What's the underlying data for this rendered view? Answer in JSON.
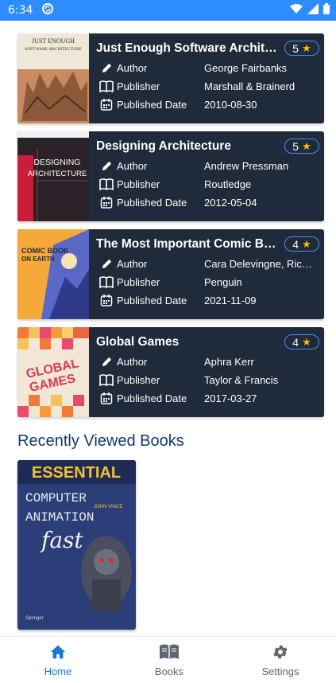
{
  "status_bar": {
    "time": "6:34"
  },
  "books": [
    {
      "title": "Just Enough Software Architecture: A Risk-Driven Approach",
      "rating": "5",
      "author_label": "Author",
      "author": "George Fairbanks",
      "publisher_label": "Publisher",
      "publisher": "Marshall & Brainerd",
      "date_label": "Published Date",
      "date": "2010-08-30",
      "cover": {
        "line1": "JUST ENOUGH",
        "line2": "SOFTWARE ARCHITECTURE"
      }
    },
    {
      "title": "Designing Architecture",
      "rating": "5",
      "author_label": "Author",
      "author": "Andrew Pressman",
      "publisher_label": "Publisher",
      "publisher": "Routledge",
      "date_label": "Published Date",
      "date": "2012-05-04",
      "cover": {
        "line1": "DESIGNING",
        "line2": "ARCHITECTURE"
      }
    },
    {
      "title": "The Most Important Comic Book on Earth",
      "rating": "4",
      "author_label": "Author",
      "author": "Cara Delevingne, Ricky Gervais",
      "publisher_label": "Publisher",
      "publisher": "Penguin",
      "date_label": "Published Date",
      "date": "2021-11-09",
      "cover": {
        "line1": "COMIC BOOK",
        "line2": "ON EARTH"
      }
    },
    {
      "title": "Global Games",
      "rating": "4",
      "author_label": "Author",
      "author": "Aphra Kerr",
      "publisher_label": "Publisher",
      "publisher": "Taylor & Francis",
      "date_label": "Published Date",
      "date": "2017-03-27",
      "cover": {
        "line1": "GLOBAL",
        "line2": "GAMES"
      }
    }
  ],
  "recent": {
    "title": "Recently Viewed Books",
    "cover": {
      "line1": "ESSENTIAL",
      "line2": "COMPUTER",
      "line3": "ANIMATION",
      "line4": "fast",
      "author": "JOHN VINCE"
    }
  },
  "nav": {
    "home": "Home",
    "books": "Books",
    "settings": "Settings",
    "active_color": "#1976d2"
  },
  "colors": {
    "status_bar": "#2d8cff",
    "card": "#1f2a3a",
    "star": "#f5c400",
    "section_title": "#123a64"
  }
}
